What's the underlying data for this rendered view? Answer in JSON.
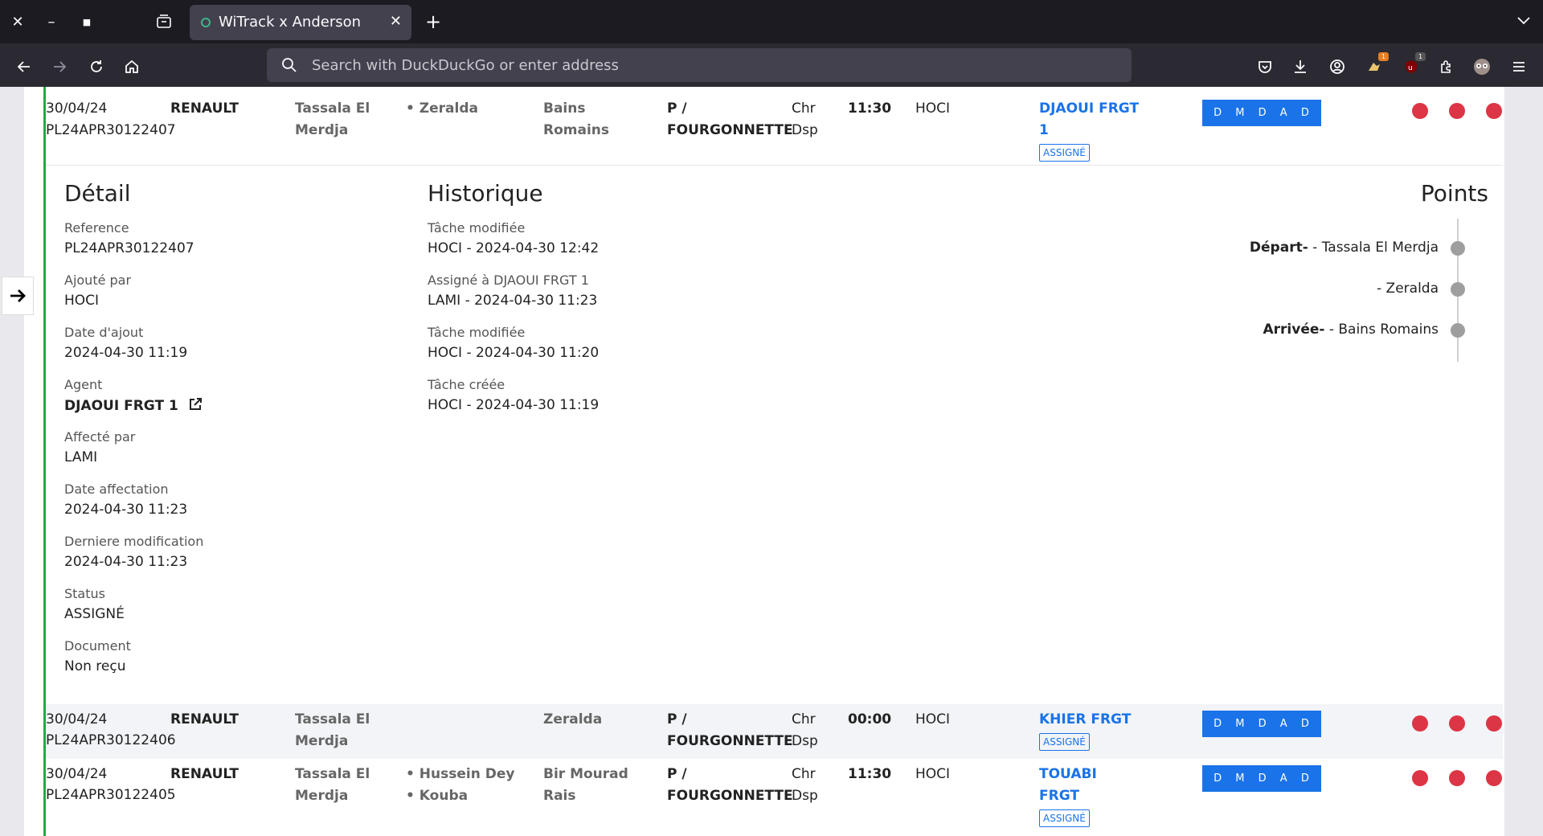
{
  "browser": {
    "tab_title": "WiTrack x Anderson",
    "url_placeholder": "Search with DuckDuckGo or enter address",
    "ext_badge_1": "1",
    "ext_badge_2": "1"
  },
  "rows": [
    {
      "date": "30/04/24",
      "reference": "PL24APR30122407",
      "brand": "RENAULT",
      "from": "Tassala El Merdja",
      "stops": [
        "Zeralda"
      ],
      "to": "Bains Romains",
      "vehicle": "P / FOURGONNETTE",
      "type": "Chr Dsp",
      "time": "11:30",
      "creator": "HOCI",
      "agent": "DJAOUI FRGT 1",
      "status": "ASSIGNÉ",
      "actions": [
        "D",
        "M",
        "D",
        "A",
        "D"
      ]
    },
    {
      "date": "30/04/24",
      "reference": "PL24APR30122406",
      "brand": "RENAULT",
      "from": "Tassala El Merdja",
      "stops": [],
      "to": "Zeralda",
      "vehicle": "P / FOURGONNETTE",
      "type": "Chr Dsp",
      "time": "00:00",
      "creator": "HOCI",
      "agent": "KHIER FRGT",
      "status": "ASSIGNÉ",
      "actions": [
        "D",
        "M",
        "D",
        "A",
        "D"
      ]
    },
    {
      "date": "30/04/24",
      "reference": "PL24APR30122405",
      "brand": "RENAULT",
      "from": "Tassala El Merdja",
      "stops": [
        "Hussein Dey",
        "Kouba"
      ],
      "to": "Bir Mourad Rais",
      "vehicle": "P / FOURGONNETTE",
      "type": "Chr Dsp",
      "time": "11:30",
      "creator": "HOCI",
      "agent": "TOUABI FRGT",
      "status": "ASSIGNÉ",
      "actions": [
        "D",
        "M",
        "D",
        "A",
        "D"
      ]
    }
  ],
  "detail": {
    "title": "Détail",
    "fields": [
      {
        "label": "Reference",
        "value": "PL24APR30122407"
      },
      {
        "label": "Ajouté par",
        "value": "HOCI"
      },
      {
        "label": "Date d'ajout",
        "value": "2024-04-30 11:19"
      },
      {
        "label": "Agent",
        "value": "DJAOUI FRGT 1"
      },
      {
        "label": "Affecté par",
        "value": "LAMI"
      },
      {
        "label": "Date affectation",
        "value": "2024-04-30 11:23"
      },
      {
        "label": "Derniere modification",
        "value": "2024-04-30 11:23"
      },
      {
        "label": "Status",
        "value": "ASSIGNÉ"
      },
      {
        "label": "Document",
        "value": "Non reçu"
      }
    ]
  },
  "history": {
    "title": "Historique",
    "entries": [
      {
        "label": "Tâche modifiée",
        "value": "HOCI - 2024-04-30 12:42"
      },
      {
        "label": "Assigné à DJAOUI FRGT 1",
        "value": "LAMI - 2024-04-30 11:23"
      },
      {
        "label": "Tâche modifiée",
        "value": "HOCI - 2024-04-30 11:20"
      },
      {
        "label": "Tâche créée",
        "value": "HOCI - 2024-04-30 11:19"
      }
    ]
  },
  "points": {
    "title": "Points",
    "items": [
      {
        "prefix": "Départ-",
        "text": " - Tassala El Merdja"
      },
      {
        "prefix": "",
        "text": "- Zeralda"
      },
      {
        "prefix": "Arrivée-",
        "text": " - Bains Romains"
      }
    ]
  },
  "colors": {
    "accent": "#1a73e8",
    "status_dot": "#dc3545",
    "row_marker": "#28a745"
  }
}
